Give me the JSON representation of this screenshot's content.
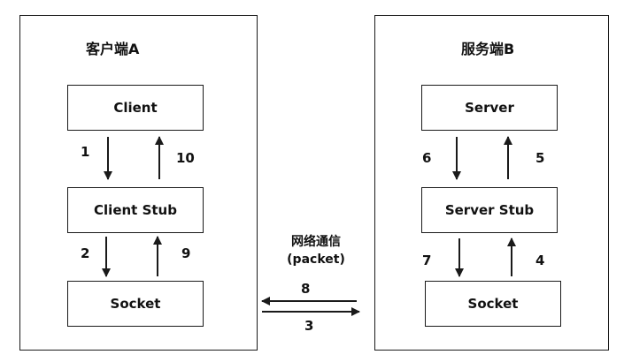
{
  "client_side": {
    "title": "客户端A",
    "client_label": "Client",
    "stub_label": "Client Stub",
    "socket_label": "Socket",
    "steps": {
      "down_top": "1",
      "up_top": "10",
      "down_bottom": "2",
      "up_bottom": "9"
    }
  },
  "server_side": {
    "title": "服务端B",
    "server_label": "Server",
    "stub_label": "Server Stub",
    "socket_label": "Socket",
    "steps": {
      "down_top": "6",
      "up_top": "5",
      "down_bottom": "7",
      "up_bottom": "4"
    }
  },
  "network": {
    "label_line1": "网络通信",
    "label_line2": "(packet)",
    "step_to_client": "8",
    "step_to_server": "3"
  }
}
